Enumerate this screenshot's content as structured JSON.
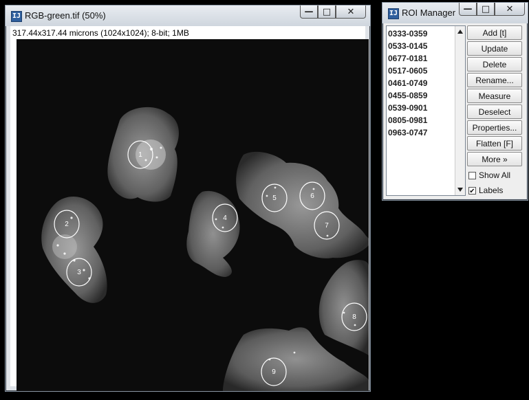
{
  "image_window": {
    "title": "RGB-green.tif (50%)",
    "icon": "imagej-icon",
    "info": "317.44x317.44 microns (1024x1024); 8-bit; 1MB",
    "controls": {
      "minimize": "—",
      "maximize": "□",
      "close": "✕"
    },
    "roi_labels": [
      "1",
      "2",
      "3",
      "4",
      "5",
      "6",
      "7",
      "8",
      "9"
    ]
  },
  "roi_manager": {
    "title": "ROI Manager",
    "icon": "imagej-icon",
    "controls": {
      "minimize": "—",
      "maximize": "□",
      "close": "✕"
    },
    "items": [
      "0333-0359",
      "0533-0145",
      "0677-0181",
      "0517-0605",
      "0461-0749",
      "0455-0859",
      "0539-0901",
      "0805-0981",
      "0963-0747"
    ],
    "buttons": {
      "add": "Add [t]",
      "update": "Update",
      "delete": "Delete",
      "rename": "Rename...",
      "measure": "Measure",
      "deselect": "Deselect",
      "properties": "Properties...",
      "flatten": "Flatten [F]",
      "more": "More »"
    },
    "checkboxes": {
      "show_all": {
        "label": "Show All",
        "checked": false
      },
      "labels": {
        "label": "Labels",
        "checked": true
      }
    }
  }
}
